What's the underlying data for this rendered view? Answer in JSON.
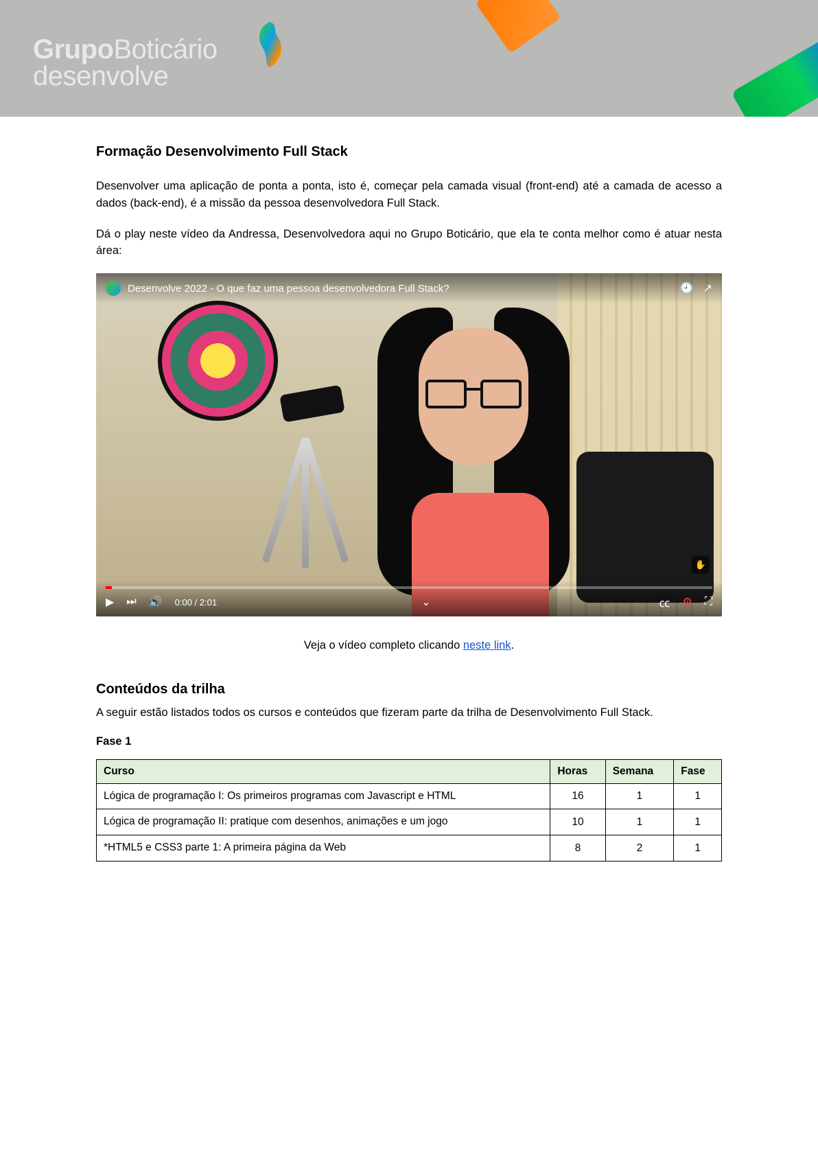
{
  "header": {
    "brand_line1_a": "Grupo",
    "brand_line1_b": "Boticário",
    "brand_line2": "desenvolve"
  },
  "intro": {
    "title": "Formação Desenvolvimento Full Stack",
    "p1": "Desenvolver uma aplicação de ponta a ponta, isto é, começar pela camada visual (front-end) até a camada de acesso a dados (back-end), é a missão da pessoa desenvolvedora Full Stack.",
    "p2": "Dá o play neste vídeo da Andressa, Desenvolvedora aqui no Grupo Boticário, que ela te conta melhor como é atuar nesta área:"
  },
  "video": {
    "title": "Desenvolve 2022 - O que faz uma pessoa desenvolvedora Full Stack?",
    "time_current": "0:00",
    "time_sep": " / ",
    "time_total": "2:01"
  },
  "caption": {
    "prefix": "Veja o vídeo completo clicando ",
    "link_text": "neste link",
    "suffix": "."
  },
  "conteudos": {
    "title": "Conteúdos da trilha",
    "intro": "A seguir estão listados todos os cursos e conteúdos que fizeram parte da trilha de Desenvolvimento Full Stack.",
    "subhead": "Fase 1",
    "columns": {
      "curso": "Curso",
      "horas": "Horas",
      "semana": "Semana",
      "fase": "Fase"
    },
    "rows": [
      {
        "curso": "Lógica de programação I: Os primeiros programas com Javascript e HTML",
        "horas": "16",
        "semana": "1",
        "fase": "1"
      },
      {
        "curso": "Lógica de programação II: pratique com desenhos, animações e um jogo",
        "horas": "10",
        "semana": "1",
        "fase": "1"
      },
      {
        "curso": "*HTML5 e CSS3 parte 1: A primeira página da Web",
        "horas": "8",
        "semana": "2",
        "fase": "1"
      }
    ]
  }
}
